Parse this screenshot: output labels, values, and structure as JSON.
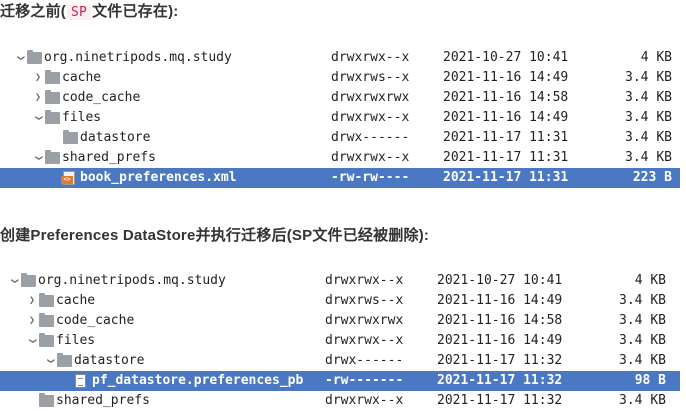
{
  "section_before": {
    "heading_prefix": "迁移之前(",
    "heading_code": "SP",
    "heading_suffix": "文件已存在):",
    "rows": [
      {
        "name": "org.ninetripods.mq.study",
        "perm": "drwxrwx--x",
        "date": "2021-10-27 10:41",
        "size": "4 KB",
        "icon": "folder-icon",
        "chevron": "down"
      },
      {
        "name": "cache",
        "perm": "drwxrws--x",
        "date": "2021-11-16 14:49",
        "size": "3.4 KB",
        "icon": "folder-icon",
        "chevron": "right"
      },
      {
        "name": "code_cache",
        "perm": "drwxrwxrwx",
        "date": "2021-11-16 14:58",
        "size": "3.4 KB",
        "icon": "folder-icon",
        "chevron": "right"
      },
      {
        "name": "files",
        "perm": "drwxrwx--x",
        "date": "2021-11-16 14:49",
        "size": "3.4 KB",
        "icon": "folder-icon",
        "chevron": "down"
      },
      {
        "name": "datastore",
        "perm": "drwx------",
        "date": "2021-11-17 11:31",
        "size": "3.4 KB",
        "icon": "folder-icon",
        "chevron": "none"
      },
      {
        "name": "shared_prefs",
        "perm": "drwxrwx--x",
        "date": "2021-11-17 11:31",
        "size": "3.4 KB",
        "icon": "folder-icon",
        "chevron": "down"
      },
      {
        "name": "book_preferences.xml",
        "perm": "-rw-rw----",
        "date": "2021-11-17 11:31",
        "size": "223 B",
        "icon": "xml-file-icon",
        "chevron": "none",
        "selected": true
      }
    ]
  },
  "section_after": {
    "heading": "创建Preferences DataStore并执行迁移后(SP文件已经被删除):",
    "rows": [
      {
        "name": "org.ninetripods.mq.study",
        "perm": "drwxrwx--x",
        "date": "2021-10-27 10:41",
        "size": "4 KB",
        "icon": "folder-icon",
        "chevron": "down"
      },
      {
        "name": "cache",
        "perm": "drwxrws--x",
        "date": "2021-11-16 14:49",
        "size": "3.4 KB",
        "icon": "folder-icon",
        "chevron": "right"
      },
      {
        "name": "code_cache",
        "perm": "drwxrwxrwx",
        "date": "2021-11-16 14:58",
        "size": "3.4 KB",
        "icon": "folder-icon",
        "chevron": "right"
      },
      {
        "name": "files",
        "perm": "drwxrwx--x",
        "date": "2021-11-16 14:49",
        "size": "3.4 KB",
        "icon": "folder-icon",
        "chevron": "down"
      },
      {
        "name": "datastore",
        "perm": "drwx------",
        "date": "2021-11-17 11:32",
        "size": "3.4 KB",
        "icon": "folder-icon",
        "chevron": "down"
      },
      {
        "name": "pf_datastore.preferences_pb",
        "perm": "-rw-------",
        "date": "2021-11-17 11:32",
        "size": "98 B",
        "icon": "text-file-icon",
        "chevron": "none",
        "selected": true
      },
      {
        "name": "shared_prefs",
        "perm": "drwxrwx--x",
        "date": "2021-11-17 11:32",
        "size": "3.4 KB",
        "icon": "folder-icon",
        "chevron": "none"
      }
    ]
  },
  "colors": {
    "selection": "#4a78c2",
    "folder": "#9aa0a6",
    "code_bg": "#fbeff1",
    "code_fg": "#c7254e"
  }
}
